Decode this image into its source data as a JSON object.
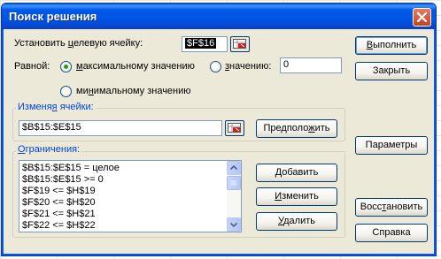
{
  "dialog": {
    "title": "Поиск решения"
  },
  "target": {
    "label_prefix": "Установить ",
    "label_underlined": "ц",
    "label_suffix": "елевую ячейку:",
    "value": "$F$16"
  },
  "equal": {
    "label": "Равной:",
    "max_prefix": "",
    "max_underlined": "м",
    "max_suffix": "аксимальному значению",
    "value_prefix": "",
    "value_underlined": "з",
    "value_suffix": "начению:",
    "value_input": "0",
    "min_prefix": "ми",
    "min_underlined": "н",
    "min_suffix": "имальному значению",
    "selected": "max"
  },
  "changing": {
    "title_prefix": "Изменя",
    "title_underlined": "я",
    "title_suffix": " ячейки:",
    "value": "$B$15:$E$15",
    "guess_prefix": "Предполо",
    "guess_underlined": "ж",
    "guess_suffix": "ить"
  },
  "constraints": {
    "title_prefix": "",
    "title_underlined": "О",
    "title_suffix": "граничения:",
    "items": [
      "$B$15:$E$15 = целое",
      "$B$15:$E$15 >= 0",
      "$F$19 <= $H$19",
      "$F$20 <= $H$20",
      "$F$21 <= $H$21",
      "$F$22 <= $H$22"
    ],
    "add_prefix": "",
    "add_underlined": "Д",
    "add_suffix": "обавить",
    "edit_prefix": "",
    "edit_underlined": "И",
    "edit_suffix": "зменить",
    "delete_prefix": "",
    "delete_underlined": "У",
    "delete_suffix": "далить"
  },
  "buttons": {
    "solve_prefix": "",
    "solve_underlined": "В",
    "solve_suffix": "ыполнить",
    "close": "Закрыть",
    "options": "Параметры",
    "reset_prefix": "Восс",
    "reset_underlined": "т",
    "reset_suffix": "ановить",
    "help": "Справка"
  }
}
